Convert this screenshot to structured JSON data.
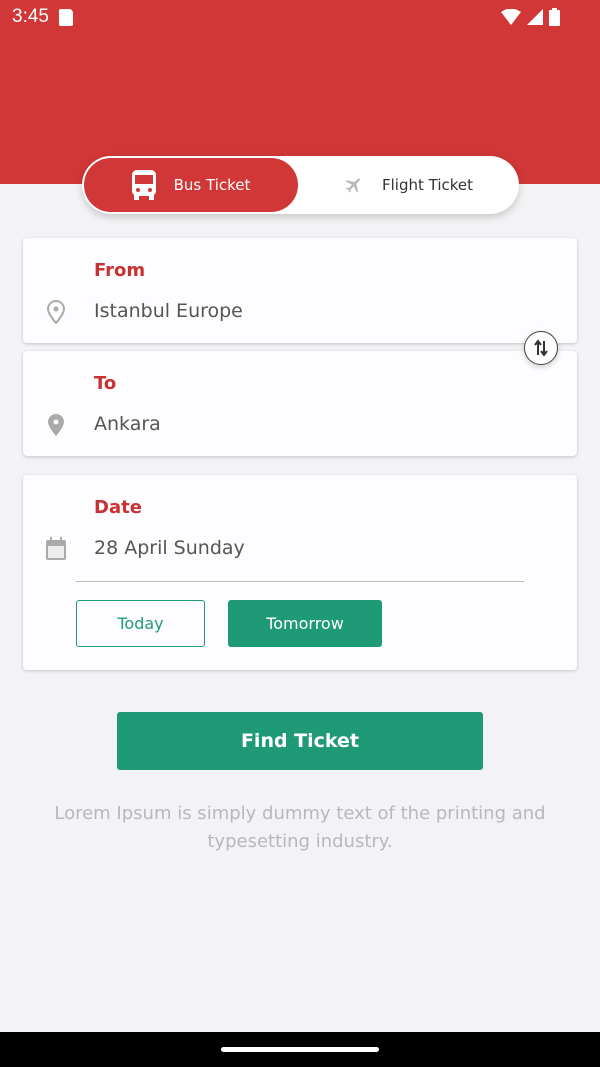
{
  "status_bar": {
    "time": "3:45"
  },
  "tabs": {
    "bus": "Bus Ticket",
    "flight": "Flight Ticket",
    "active": "bus"
  },
  "from": {
    "label": "From",
    "value": "Istanbul Europe"
  },
  "to": {
    "label": "To",
    "value": "Ankara"
  },
  "date": {
    "label": "Date",
    "value": "28 April Sunday",
    "today": "Today",
    "tomorrow": "Tomorrow"
  },
  "find_button": "Find Ticket",
  "description": "Lorem Ipsum is simply dummy text of the printing and typesetting industry.",
  "colors": {
    "primary": "#d13737",
    "accent": "#1f9a77",
    "background": "#f3f2f4"
  }
}
